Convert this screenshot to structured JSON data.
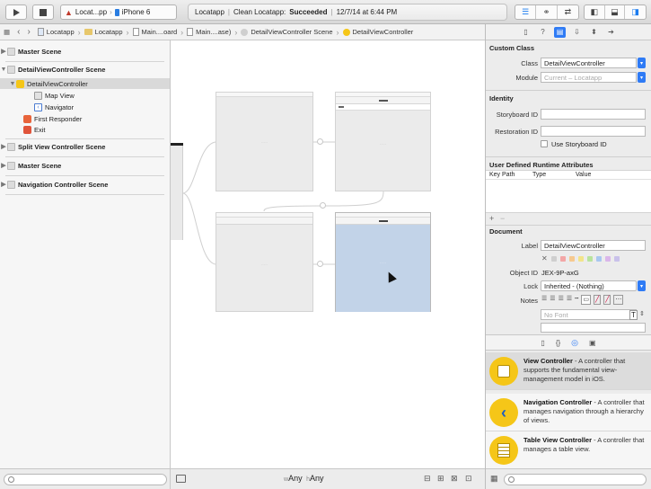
{
  "toolbar": {
    "scheme_target": "Locat...pp",
    "scheme_device": "iPhone 6",
    "activity_app": "Locatapp",
    "activity_prefix": "Clean Locatapp:",
    "activity_status": "Succeeded",
    "activity_time": "12/7/14 at 6:44 PM"
  },
  "jumpbar": {
    "items": [
      "Locatapp",
      "Locatapp",
      "Main....oard",
      "Main....ase)",
      "DetailViewController Scene",
      "DetailViewController"
    ]
  },
  "outline": {
    "master_scene": "Master Scene",
    "detail_scene": "DetailViewController Scene",
    "detail_vc": "DetailViewController",
    "map_view": "Map View",
    "navigator": "Navigator",
    "first_responder": "First Responder",
    "exit": "Exit",
    "split_scene": "Split View Controller Scene",
    "master_scene_2": "Master Scene",
    "nav_scene": "Navigation Controller Scene"
  },
  "canvas": {
    "size_class_w": "Any",
    "size_class_h": "Any"
  },
  "inspector": {
    "custom_class": {
      "title": "Custom Class",
      "class_label": "Class",
      "class_value": "DetailViewController",
      "module_label": "Module",
      "module_placeholder": "Current – Locatapp"
    },
    "identity": {
      "title": "Identity",
      "storyboard_id_label": "Storyboard ID",
      "restoration_id_label": "Restoration ID",
      "use_storyboard_id_label": "Use Storyboard ID"
    },
    "runtime_attrs": {
      "title": "User Defined Runtime Attributes",
      "col_key_path": "Key Path",
      "col_type": "Type",
      "col_value": "Value"
    },
    "document": {
      "title": "Document",
      "label_label": "Label",
      "label_value": "DetailViewController",
      "object_id_label": "Object ID",
      "object_id_value": "JEX-9P-axG",
      "lock_label": "Lock",
      "lock_value": "Inherited - (Nothing)",
      "notes_label": "Notes",
      "font_placeholder": "No Font"
    }
  },
  "library": {
    "items": [
      {
        "name": "View Controller",
        "desc": " - A controller that supports the fundamental view-management model in iOS."
      },
      {
        "name": "Navigation Controller",
        "desc": " - A controller that manages navigation through a hierarchy of views."
      },
      {
        "name": "Table View Controller",
        "desc": " - A controller that manages a table view."
      }
    ]
  }
}
